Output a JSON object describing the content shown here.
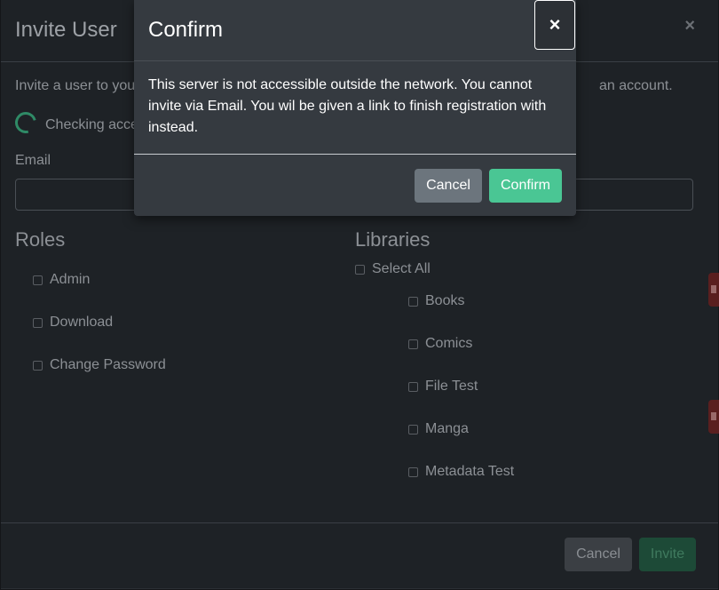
{
  "invite": {
    "title": "Invite User",
    "close_symbol": "×",
    "description_start": "Invite a user to you",
    "description_end": "an account.",
    "checking_text": "Checking acce",
    "email_label": "Email",
    "roles_title": "Roles",
    "roles": [
      "Admin",
      "Download",
      "Change Password"
    ],
    "libraries_title": "Libraries",
    "select_all_label": "Select All",
    "libraries": [
      "Books",
      "Comics",
      "File Test",
      "Manga",
      "Metadata Test"
    ],
    "cancel_label": "Cancel",
    "invite_label": "Invite"
  },
  "confirm": {
    "title": "Confirm",
    "close_symbol": "×",
    "message": "This server is not accessible outside the network. You cannot invite via Email. You wil be given a link to finish registration with instead.",
    "cancel_label": "Cancel",
    "confirm_label": "Confirm"
  },
  "colors": {
    "accent": "#4ac694",
    "secondary": "#6c757d",
    "danger": "#5a1f1f"
  }
}
